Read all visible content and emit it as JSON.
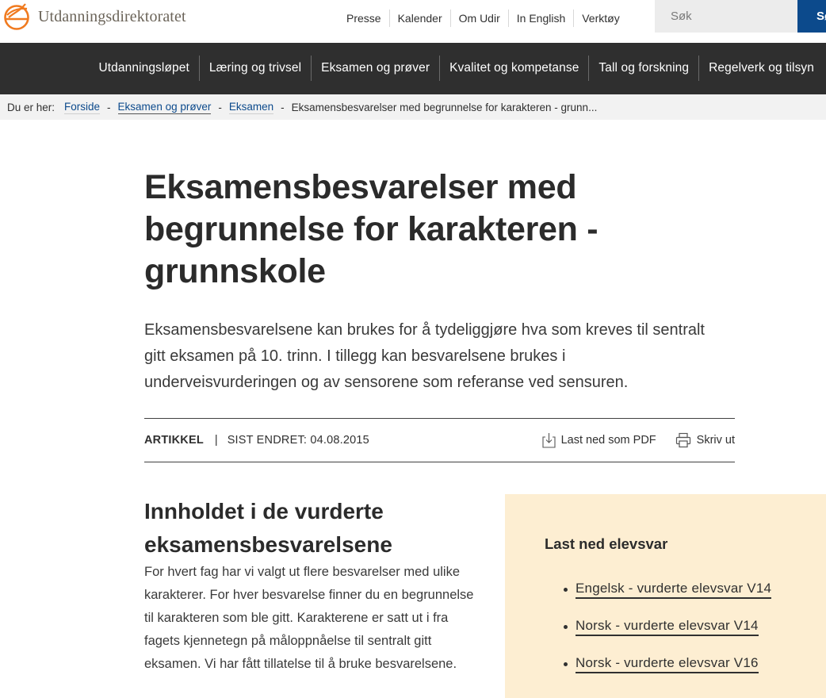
{
  "header": {
    "logo_text": "Utdanningsdirektoratet",
    "utility_links": [
      "Presse",
      "Kalender",
      "Om Udir",
      "In English",
      "Verktøy"
    ],
    "search": {
      "placeholder": "Søk",
      "button_label": "Søk"
    },
    "brand_color": "#f07a1f",
    "accent_color": "#0c4a8c"
  },
  "main_nav": {
    "items": [
      "Utdanningsløpet",
      "Læring og trivsel",
      "Eksamen og prøver",
      "Kvalitet og kompetanse",
      "Tall og forskning",
      "Regelverk og tilsyn"
    ]
  },
  "breadcrumb": {
    "label": "Du er her:",
    "links": [
      "Forside",
      "Eksamen og prøver",
      "Eksamen"
    ],
    "current": "Eksamensbesvarelser med begrunnelse for karakteren - grunn...",
    "separator": "-"
  },
  "article": {
    "title": "Eksamensbesvarelser med begrunnelse for karakteren - grunnskole",
    "ingress": "Eksamensbesvarelsene kan brukes for å tydeliggjøre hva som kreves til sentralt gitt eksamen på 10. trinn. I tillegg kan besvarelsene brukes i underveisvurderingen og av sensorene som referanse ved sensuren.",
    "meta": {
      "type": "ARTIKKEL",
      "separator": "|",
      "last_changed": "SIST ENDRET: 04.08.2015",
      "download_pdf_label": "Last ned som PDF",
      "print_label": "Skriv ut"
    },
    "section": {
      "heading": "Innholdet i de vurderte eksamensbesvarelsene",
      "body": "For hvert fag har vi valgt ut flere besvarelser med ulike karakterer. For hver besvarelse finner du en begrunnelse til karakteren som ble gitt. Karakterene er satt ut i fra fagets kjennetegn på måloppnåelse til sentralt gitt eksamen. Vi har fått tillatelse til å bruke besvarelsene."
    }
  },
  "aside": {
    "title": "Last ned elevsvar",
    "links": [
      "Engelsk - vurderte elevsvar V14",
      "Norsk - vurderte elevsvar V14",
      "Norsk - vurderte elevsvar V16"
    ],
    "background": "#fdeed2"
  }
}
